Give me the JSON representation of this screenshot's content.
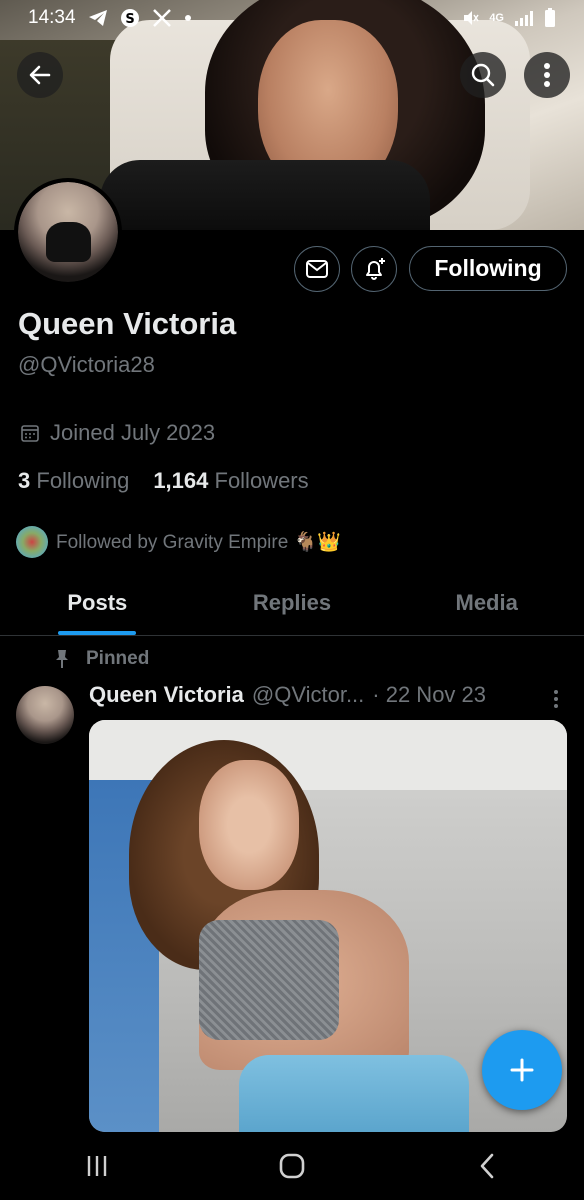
{
  "status_bar": {
    "time": "14:34",
    "left_icons": [
      "telegram-icon",
      "shazam-icon",
      "x-icon",
      "dot-icon"
    ],
    "right_icons": [
      "mute-icon",
      "4g-icon",
      "signal-icon",
      "battery-icon"
    ],
    "network": "4G"
  },
  "profile": {
    "name": "Queen Victoria",
    "handle": "@QVictoria28",
    "joined": "Joined July 2023",
    "following_count": "3",
    "following_label": "Following",
    "followers_count": "1,164",
    "followers_label": "Followers",
    "followed_by": "Followed by Gravity Empire 🐐👑",
    "follow_button_label": "Following"
  },
  "tabs": [
    {
      "label": "Posts",
      "active": true
    },
    {
      "label": "Replies",
      "active": false
    },
    {
      "label": "Media",
      "active": false
    }
  ],
  "post": {
    "pinned_label": "Pinned",
    "author_name": "Queen Victoria",
    "author_handle": "@QVictor...",
    "date": "· 22 Nov 23"
  },
  "colors": {
    "accent": "#1d9bf0",
    "background": "#000000",
    "text_primary": "#e7e9ea",
    "text_secondary": "#71767b",
    "border": "#2f3336"
  }
}
